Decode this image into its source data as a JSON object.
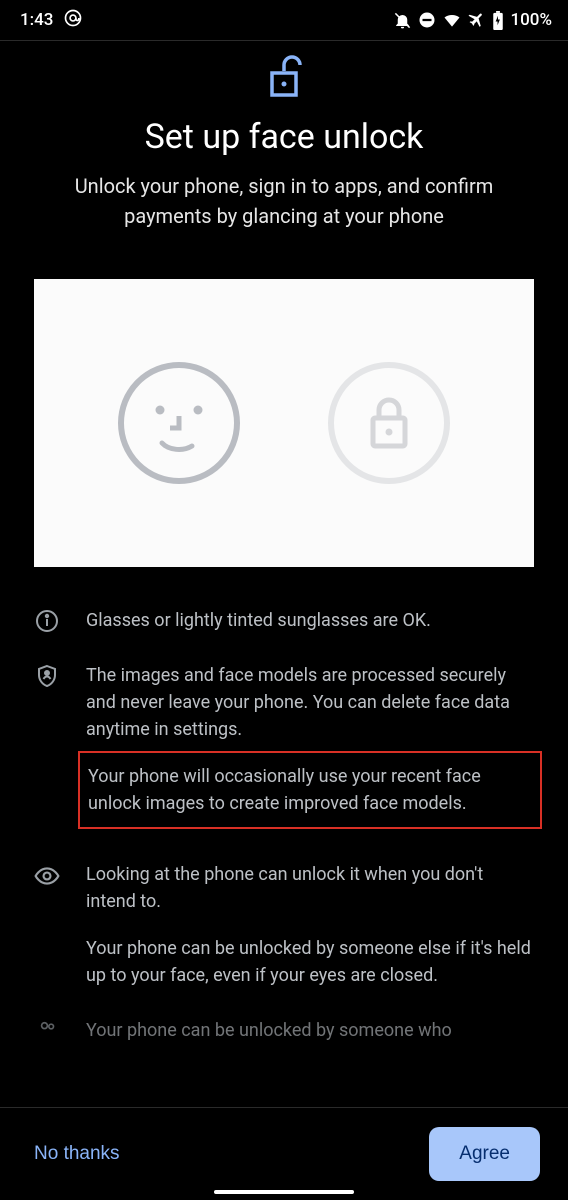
{
  "status": {
    "time": "1:43",
    "battery": "100%"
  },
  "hero": {
    "title": "Set up face unlock",
    "subtitle": "Unlock your phone, sign in to apps, and confirm payments by glancing at your phone"
  },
  "info": {
    "glasses": "Glasses or lightly tinted sunglasses are OK.",
    "privacy1": "The images and face models are processed securely and never leave your phone. You can delete face data anytime in settings.",
    "privacy2_highlighted": "Your phone will occasionally use your recent face unlock images to create improved face models.",
    "look1": "Looking at the phone can unlock it when you don't intend to.",
    "look2": "Your phone can be unlocked by someone else if it's held up to your face, even if your eyes are closed.",
    "cutoff": "Your phone can be unlocked by someone who"
  },
  "footer": {
    "decline": "No thanks",
    "accept": "Agree"
  }
}
